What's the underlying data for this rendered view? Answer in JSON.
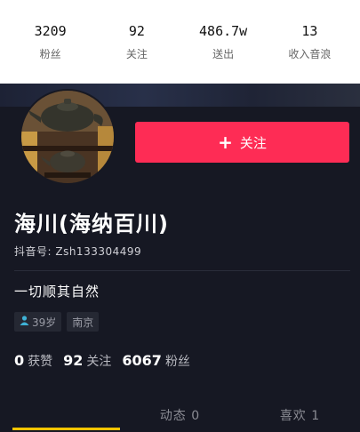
{
  "top_stats": [
    {
      "value": "3209",
      "label": "粉丝"
    },
    {
      "value": "92",
      "label": "关注"
    },
    {
      "value": "486.7w",
      "label": "送出"
    },
    {
      "value": "13",
      "label": "收入音浪"
    }
  ],
  "profile": {
    "follow_button": "关注",
    "name": "海川(海纳百川)",
    "douyin_id": "抖音号: Zsh133304499",
    "bio": "一切顺其自然",
    "age_tag": "39岁",
    "location_tag": "南京",
    "stats": [
      {
        "num": "0",
        "label": "获赞"
      },
      {
        "num": "92",
        "label": "关注"
      },
      {
        "num": "6067",
        "label": "粉丝"
      }
    ]
  },
  "tabs": [
    {
      "label": ""
    },
    {
      "label": "动态 0"
    },
    {
      "label": "喜欢 1"
    }
  ],
  "colors": {
    "accent": "#fe2c55",
    "tab_indicator": "#f5c400",
    "background": "#161823"
  }
}
